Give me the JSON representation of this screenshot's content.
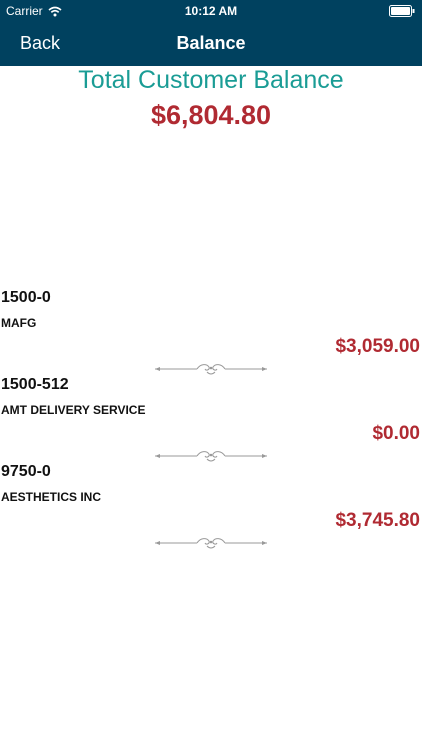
{
  "status_bar": {
    "carrier": "Carrier",
    "time": "10:12 AM",
    "icons": [
      "wifi-icon",
      "battery-icon"
    ]
  },
  "nav": {
    "back_label": "Back",
    "title": "Balance"
  },
  "summary": {
    "title": "Total Customer Balance",
    "amount": "$6,804.80"
  },
  "accounts": [
    {
      "number": "1500-0",
      "name": "MAFG",
      "balance": "$3,059.00"
    },
    {
      "number": "1500-512",
      "name": "AMT DELIVERY SERVICE",
      "balance": "$0.00"
    },
    {
      "number": "9750-0",
      "name": "AESTHETICS INC",
      "balance": "$3,745.80"
    }
  ],
  "colors": {
    "nav_background": "#00415f",
    "title_teal": "#1a9c95",
    "amount_red": "#b02a32"
  }
}
